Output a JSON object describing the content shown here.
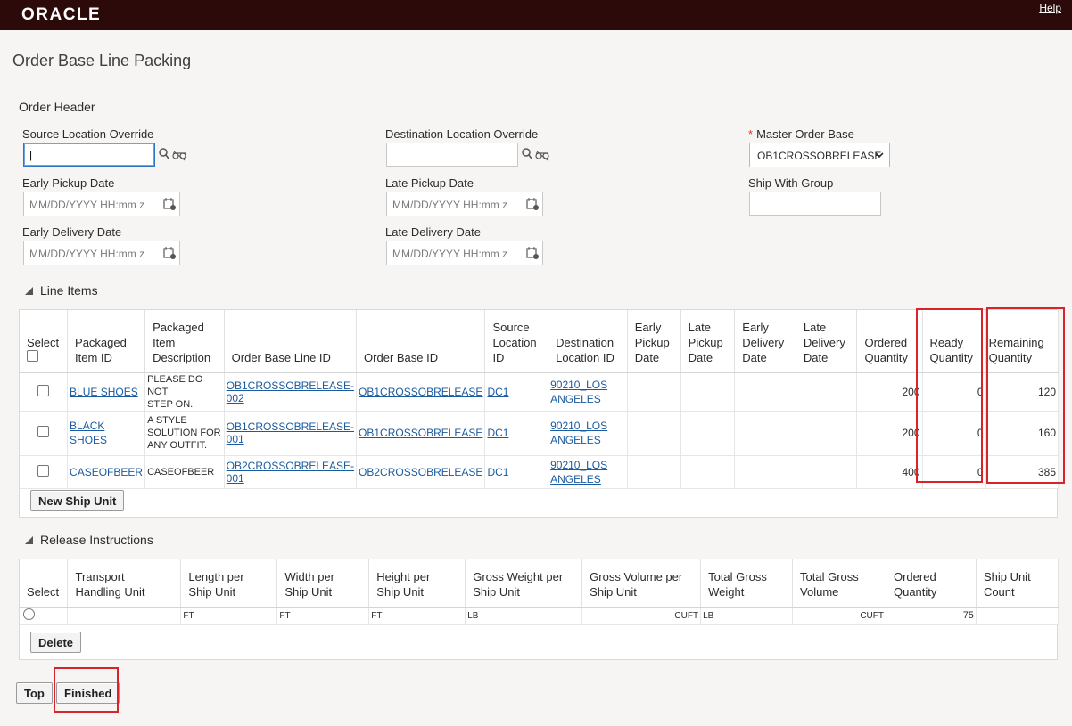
{
  "header": {
    "logo_text": "ORACLE",
    "help_label": "Help"
  },
  "page_title": "Order Base Line Packing",
  "order_header": {
    "title": "Order Header",
    "source_location_override": {
      "label": "Source Location Override",
      "value": "|"
    },
    "destination_location_override": {
      "label": "Destination Location Override",
      "value": ""
    },
    "master_order_base": {
      "label": "Master Order Base",
      "required": "*",
      "value": "OB1CROSSOBRELEASE"
    },
    "early_pickup_date": {
      "label": "Early Pickup Date",
      "placeholder": "MM/DD/YYYY HH:mm z"
    },
    "late_pickup_date": {
      "label": "Late Pickup Date",
      "placeholder": "MM/DD/YYYY HH:mm z"
    },
    "ship_with_group": {
      "label": "Ship With Group",
      "value": ""
    },
    "early_delivery_date": {
      "label": "Early Delivery Date",
      "placeholder": "MM/DD/YYYY HH:mm z"
    },
    "late_delivery_date": {
      "label": "Late Delivery Date",
      "placeholder": "MM/DD/YYYY HH:mm z"
    }
  },
  "line_items": {
    "title": "Line Items",
    "columns": {
      "select": "Select",
      "packaged_item_id": [
        "Packaged",
        "Item ID"
      ],
      "packaged_item_description": [
        "Packaged",
        "Item",
        "Description"
      ],
      "order_base_line_id": "Order Base Line ID",
      "order_base_id": "Order Base ID",
      "source_location_id": [
        "Source",
        "Location",
        "ID"
      ],
      "destination_location_id": [
        "Destination",
        "Location ID"
      ],
      "early_pickup_date": [
        "Early",
        "Pickup",
        "Date"
      ],
      "late_pickup_date": [
        "Late",
        "Pickup",
        "Date"
      ],
      "early_delivery_date": [
        "Early",
        "Delivery",
        "Date"
      ],
      "late_delivery_date": [
        "Late",
        "Delivery",
        "Date"
      ],
      "ordered_quantity": [
        "Ordered",
        "Quantity"
      ],
      "ready_quantity": [
        "Ready",
        "Quantity"
      ],
      "remaining_quantity": [
        "Remaining",
        "Quantity"
      ]
    },
    "rows": [
      {
        "item_id": [
          "BLUE SHOES"
        ],
        "description": [
          "PLEASE DO NOT",
          "STEP ON."
        ],
        "order_base_line_id": "OB1CROSSOBRELEASE-002",
        "order_base_id": "OB1CROSSOBRELEASE",
        "source_location_id": "DC1",
        "destination_location_id": [
          "90210_LOS",
          "ANGELES"
        ],
        "ordered_quantity": "200",
        "ready_quantity": "0",
        "remaining_quantity": "120"
      },
      {
        "item_id": [
          "BLACK",
          "SHOES"
        ],
        "description": [
          "A STYLE",
          "SOLUTION FOR",
          "ANY OUTFIT."
        ],
        "order_base_line_id": "OB1CROSSOBRELEASE-001",
        "order_base_id": "OB1CROSSOBRELEASE",
        "source_location_id": "DC1",
        "destination_location_id": [
          "90210_LOS",
          "ANGELES"
        ],
        "ordered_quantity": "200",
        "ready_quantity": "0",
        "remaining_quantity": "160"
      },
      {
        "item_id": [
          "CASEOFBEER"
        ],
        "description": [
          "CASEOFBEER"
        ],
        "order_base_line_id": "OB2CROSSOBRELEASE-001",
        "order_base_id": "OB2CROSSOBRELEASE",
        "source_location_id": "DC1",
        "destination_location_id": [
          "90210_LOS",
          "ANGELES"
        ],
        "ordered_quantity": "400",
        "ready_quantity": "0",
        "remaining_quantity": "385"
      }
    ],
    "new_ship_unit_label": "New Ship Unit"
  },
  "release_instructions": {
    "title": "Release Instructions",
    "columns": {
      "select": "Select",
      "transport_handling_unit": [
        "Transport",
        "Handling Unit"
      ],
      "length_per_ship_unit": [
        "Length per",
        "Ship Unit"
      ],
      "width_per_ship_unit": [
        "Width per",
        "Ship Unit"
      ],
      "height_per_ship_unit": [
        "Height per",
        "Ship Unit"
      ],
      "gross_weight_per_ship_unit": [
        "Gross Weight per",
        "Ship Unit"
      ],
      "gross_volume_per_ship_unit": [
        "Gross Volume per",
        "Ship Unit"
      ],
      "total_gross_weight": [
        "Total Gross",
        "Weight"
      ],
      "total_gross_volume": [
        "Total Gross",
        "Volume"
      ],
      "ordered_quantity": [
        "Ordered",
        "Quantity"
      ],
      "ship_unit_count": [
        "Ship Unit",
        "Count"
      ]
    },
    "rows": [
      {
        "length_uom": "FT",
        "width_uom": "FT",
        "height_uom": "FT",
        "gross_weight_uom": "LB",
        "gross_volume_uom": "CUFT",
        "total_gross_weight_uom": "LB",
        "total_gross_volume_uom": "CUFT",
        "ordered_quantity": "75"
      }
    ],
    "delete_label": "Delete"
  },
  "footer": {
    "top_label": "Top",
    "finished_label": "Finished"
  },
  "colors": {
    "brand_bar": "#2c0a0a",
    "link": "#1a5a9e",
    "highlight": "#d6242a",
    "required": "#d63b25"
  }
}
